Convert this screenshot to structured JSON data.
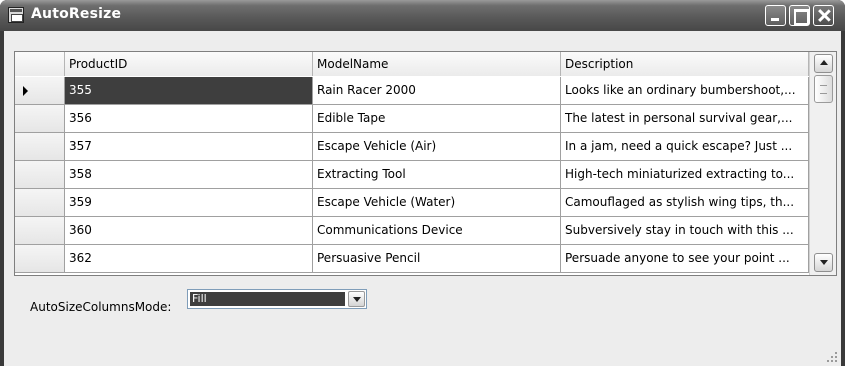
{
  "window": {
    "title": "AutoResize"
  },
  "grid": {
    "columns": [
      "ProductID",
      "ModelName",
      "Description"
    ],
    "rows": [
      [
        "355",
        "Rain Racer 2000",
        "Looks like an ordinary bumbershoot,..."
      ],
      [
        "356",
        "Edible Tape",
        "The latest in personal survival gear,..."
      ],
      [
        "357",
        "Escape Vehicle (Air)",
        "In a jam, need a quick escape? Just ..."
      ],
      [
        "358",
        "Extracting Tool",
        "High-tech miniaturized extracting to..."
      ],
      [
        "359",
        "Escape Vehicle (Water)",
        "Camouflaged as stylish wing tips, th..."
      ],
      [
        "360",
        "Communications Device",
        "Subversively stay in touch with this ..."
      ],
      [
        "362",
        "Persuasive Pencil",
        "Persuade anyone to see your point ..."
      ]
    ],
    "selected_cell": {
      "row": 0,
      "column": "ProductID"
    }
  },
  "mode": {
    "label": "AutoSizeColumnsMode:",
    "selected": "Fill"
  },
  "icons": [
    "app-icon",
    "minimize-icon",
    "maximize-icon",
    "close-icon",
    "row-indicator-arrow-icon",
    "scroll-up-icon",
    "scroll-down-icon",
    "dropdown-arrow-icon",
    "size-grip-icon"
  ],
  "colors": {
    "selection": "#3e3e3e",
    "titlebar": "#5a5a5a",
    "background": "#ededed"
  }
}
